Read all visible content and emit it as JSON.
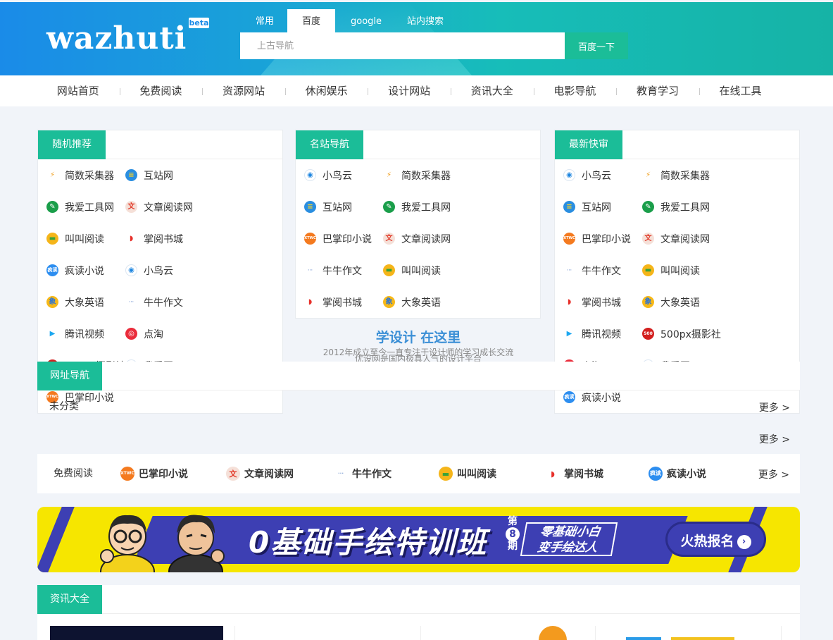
{
  "header": {
    "logo": "wazhuti",
    "beta": "beta",
    "search_tabs": [
      "常用",
      "百度",
      "google",
      "站内搜索"
    ],
    "active_tab": "百度",
    "search_placeholder": "上古导航",
    "search_button": "百度一下"
  },
  "nav": [
    "网站首页",
    "免费阅读",
    "资源网站",
    "休闲娱乐",
    "设计网站",
    "资讯大全",
    "电影导航",
    "教育学习",
    "在线工具"
  ],
  "cards": [
    {
      "title": "随机推荐",
      "items": [
        {
          "label": "简数采集器",
          "icon": "jianshu"
        },
        {
          "label": "互站网",
          "icon": "huzhan"
        },
        {
          "label": "我爱工具网",
          "icon": "tools"
        },
        {
          "label": "文章阅读网",
          "icon": "wenzhang"
        },
        {
          "label": "叫叫阅读",
          "icon": "jiaojiao"
        },
        {
          "label": "掌阅书城",
          "icon": "zhangyue"
        },
        {
          "label": "疯读小说",
          "icon": "fengdu"
        },
        {
          "label": "小鸟云",
          "icon": "niaoyun"
        },
        {
          "label": "大象英语",
          "icon": "daxiang"
        },
        {
          "label": "牛牛作文",
          "icon": "niuniu"
        },
        {
          "label": "腾讯视频",
          "icon": "tencent"
        },
        {
          "label": "点淘",
          "icon": "diantao"
        },
        {
          "label": "500px摄影社区",
          "icon": "500px"
        },
        {
          "label": "我爱网",
          "icon": "woai"
        },
        {
          "label": "巴掌印小说",
          "icon": "bazhang"
        }
      ]
    },
    {
      "title": "名站导航",
      "items": [
        {
          "label": "小鸟云",
          "icon": "niaoyun"
        },
        {
          "label": "简数采集器",
          "icon": "jianshu"
        },
        {
          "label": "互站网",
          "icon": "huzhan"
        },
        {
          "label": "我爱工具网",
          "icon": "tools"
        },
        {
          "label": "巴掌印小说",
          "icon": "bazhang"
        },
        {
          "label": "文章阅读网",
          "icon": "wenzhang"
        },
        {
          "label": "牛牛作文",
          "icon": "niuniu"
        },
        {
          "label": "叫叫阅读",
          "icon": "jiaojiao"
        },
        {
          "label": "掌阅书城",
          "icon": "zhangyue"
        },
        {
          "label": "大象英语",
          "icon": "daxiang"
        }
      ]
    },
    {
      "title": "最新快审",
      "items": [
        {
          "label": "小鸟云",
          "icon": "niaoyun"
        },
        {
          "label": "简数采集器",
          "icon": "jianshu"
        },
        {
          "label": "互站网",
          "icon": "huzhan"
        },
        {
          "label": "我爱工具网",
          "icon": "tools"
        },
        {
          "label": "巴掌印小说",
          "icon": "bazhang"
        },
        {
          "label": "文章阅读网",
          "icon": "wenzhang"
        },
        {
          "label": "牛牛作文",
          "icon": "niuniu"
        },
        {
          "label": "叫叫阅读",
          "icon": "jiaojiao"
        },
        {
          "label": "掌阅书城",
          "icon": "zhangyue"
        },
        {
          "label": "大象英语",
          "icon": "daxiang"
        },
        {
          "label": "腾讯视频",
          "icon": "tencent"
        },
        {
          "label": "500px摄影社区",
          "icon": "500px"
        },
        {
          "label": "点淘",
          "icon": "diantao"
        },
        {
          "label": "我爱网",
          "icon": "woai"
        },
        {
          "label": "疯读小说",
          "icon": "fengdu"
        }
      ]
    }
  ],
  "slogan": {
    "title": "学设计 在这里",
    "line1": "2012年成立至今一直专注于设计师的学习成长交流",
    "line2": "优设网是国内极具人气的设计平台"
  },
  "links_panel": {
    "title": "网址导航",
    "uncategorized": "未分类",
    "more": "更多 >"
  },
  "free_reading": {
    "label": "免费阅读",
    "items": [
      {
        "label": "巴掌印小说",
        "icon": "bazhang"
      },
      {
        "label": "文章阅读网",
        "icon": "wenzhang"
      },
      {
        "label": "牛牛作文",
        "icon": "niuniu"
      },
      {
        "label": "叫叫阅读",
        "icon": "jiaojiao"
      },
      {
        "label": "掌阅书城",
        "icon": "zhangyue"
      },
      {
        "label": "疯读小说",
        "icon": "fengdu"
      }
    ],
    "more": "更多 >"
  },
  "banner": {
    "title": "0基础手绘特训班",
    "issue_prefix": "第",
    "issue_num": "8",
    "issue_suffix": "期",
    "tag_line1": "零基础小白",
    "tag_line2": "变手绘达人",
    "cta": "火热报名",
    "cta_icon": "›"
  },
  "news": {
    "title": "资讯大全"
  },
  "icon_styles": {
    "jianshu": {
      "bg": "transparent",
      "fg": "#f0a020",
      "glyph": "⚡"
    },
    "huzhan": {
      "bg": "#2a8ee0",
      "fg": "#ffd21f",
      "glyph": "≡"
    },
    "tools": {
      "bg": "#1a9e4a",
      "fg": "#ffffff",
      "glyph": "✎"
    },
    "wenzhang": {
      "bg": "#f5e0d8",
      "fg": "#e23b2b",
      "glyph": "文"
    },
    "jiaojiao": {
      "bg": "#f5b51a",
      "fg": "#3aa23a",
      "glyph": "▬"
    },
    "zhangyue": {
      "bg": "transparent",
      "fg": "#e7302a",
      "glyph": "◗"
    },
    "fengdu": {
      "bg": "#2d8ef0",
      "fg": "#ffffff",
      "glyph": "疯读"
    },
    "niaoyun": {
      "bg": "#ffffff",
      "fg": "#1e86e0",
      "glyph": "◉"
    },
    "daxiang": {
      "bg": "#f6b818",
      "fg": "#2a74d8",
      "glyph": "象"
    },
    "niuniu": {
      "bg": "transparent",
      "fg": "#8aa7d8",
      "glyph": "···"
    },
    "tencent": {
      "bg": "transparent",
      "fg": "#1ca7f0",
      "glyph": "▶"
    },
    "diantao": {
      "bg": "#ea2c3b",
      "fg": "#ffffff",
      "glyph": "◎"
    },
    "500px": {
      "bg": "#d3201f",
      "fg": "#ffffff",
      "glyph": "500"
    },
    "woai": {
      "bg": "#ffffff",
      "fg": "#1a73c8",
      "glyph": "W"
    },
    "bazhang": {
      "bg": "#f47a1f",
      "fg": "#ffffff",
      "glyph": "XTWC"
    }
  }
}
